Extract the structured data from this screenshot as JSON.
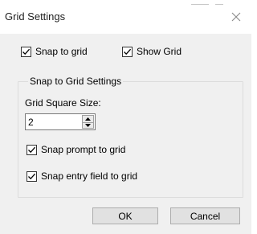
{
  "window": {
    "title": "Grid Settings",
    "close_icon": "close-icon"
  },
  "options": {
    "snap_to_grid": {
      "label": "Snap to grid",
      "checked": true
    },
    "show_grid": {
      "label": "Show Grid",
      "checked": true
    }
  },
  "group": {
    "title": "Snap to Grid Settings",
    "grid_square_size_label": "Grid Square Size:",
    "grid_square_size_value": "2",
    "snap_prompt": {
      "label": "Snap prompt to grid",
      "checked": true
    },
    "snap_entry_field": {
      "label": "Snap entry field to grid",
      "checked": true
    }
  },
  "buttons": {
    "ok": "OK",
    "cancel": "Cancel"
  }
}
